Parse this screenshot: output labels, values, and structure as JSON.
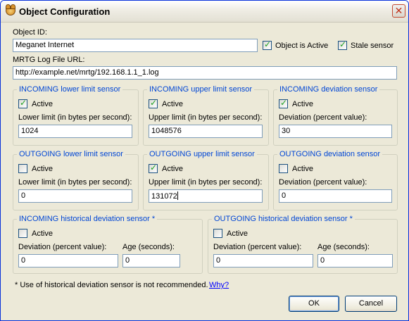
{
  "window": {
    "title": "Object Configuration",
    "close_glyph": "✕",
    "icon": "cat-app-icon"
  },
  "object": {
    "id_label": "Object ID:",
    "id_value": "Meganet Internet",
    "active_label": "Object is Active",
    "active_checked": true,
    "stale_label": "Stale sensor",
    "stale_checked": true,
    "mrtg_label": "MRTG Log File URL:",
    "mrtg_value": "http://example.net/mrtg/192.168.1.1_1.log"
  },
  "sensors": {
    "in_lower": {
      "title": "INCOMING lower limit sensor",
      "active_label": "Active",
      "active": true,
      "field_label": "Lower limit (in bytes per second):",
      "value": "1024"
    },
    "in_upper": {
      "title": "INCOMING upper limit sensor",
      "active_label": "Active",
      "active": true,
      "field_label": "Upper limit (in bytes per second):",
      "value": "1048576"
    },
    "in_dev": {
      "title": "INCOMING deviation sensor",
      "active_label": "Active",
      "active": true,
      "field_label": "Deviation (percent value):",
      "value": "30"
    },
    "out_lower": {
      "title": "OUTGOING lower limit sensor",
      "active_label": "Active",
      "active": false,
      "field_label": "Lower limit (in bytes per second):",
      "value": "0"
    },
    "out_upper": {
      "title": "OUTGOING upper limit sensor",
      "active_label": "Active",
      "active": true,
      "field_label": "Upper limit (in bytes per second):",
      "value": "131072"
    },
    "out_dev": {
      "title": "OUTGOING deviation sensor",
      "active_label": "Active",
      "active": false,
      "field_label": "Deviation (percent value):",
      "value": "0"
    }
  },
  "historical": {
    "incoming": {
      "title": "INCOMING historical deviation sensor *",
      "active_label": "Active",
      "active": false,
      "dev_label": "Deviation (percent value):",
      "dev_value": "0",
      "age_label": "Age (seconds):",
      "age_value": "0"
    },
    "outgoing": {
      "title": "OUTGOING historical deviation sensor *",
      "active_label": "Active",
      "active": false,
      "dev_label": "Deviation (percent value):",
      "dev_value": "0",
      "age_label": "Age (seconds):",
      "age_value": "0"
    }
  },
  "footer": {
    "note": "* Use of historical deviation sensor is not recommended.",
    "link": "Why?",
    "ok_label": "OK",
    "cancel_label": "Cancel"
  },
  "colors": {
    "legend": "#0046d5",
    "window_bg": "#ece9d8",
    "link": "#0000ff",
    "check": "#21a121"
  }
}
